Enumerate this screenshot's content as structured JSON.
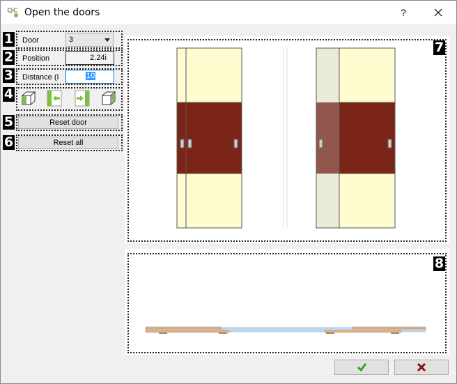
{
  "window": {
    "title": "Open the doors"
  },
  "titlebar": {
    "help_label": "?"
  },
  "form": {
    "door": {
      "badge": "1",
      "label": "Door",
      "value": "3"
    },
    "position": {
      "badge": "2",
      "label": "Position",
      "value": "2.24i"
    },
    "distance": {
      "badge": "3",
      "label": "Distance (I",
      "value": "10"
    },
    "actions": {
      "badge": "4"
    },
    "reset_door": {
      "badge": "5",
      "label": "Reset door"
    },
    "reset_all": {
      "badge": "6",
      "label": "Reset all"
    }
  },
  "front_view": {
    "badge": "7"
  },
  "top_view": {
    "badge": "8"
  },
  "colors": {
    "door_yellow": "#fffdd0",
    "door_wood": "#7a2518",
    "door_grey": "#e6e6da",
    "accent": "#0078d7",
    "ok_green": "#3a9a2a",
    "cancel_red": "#8b1010",
    "icon_green": "#7fbf3f"
  }
}
